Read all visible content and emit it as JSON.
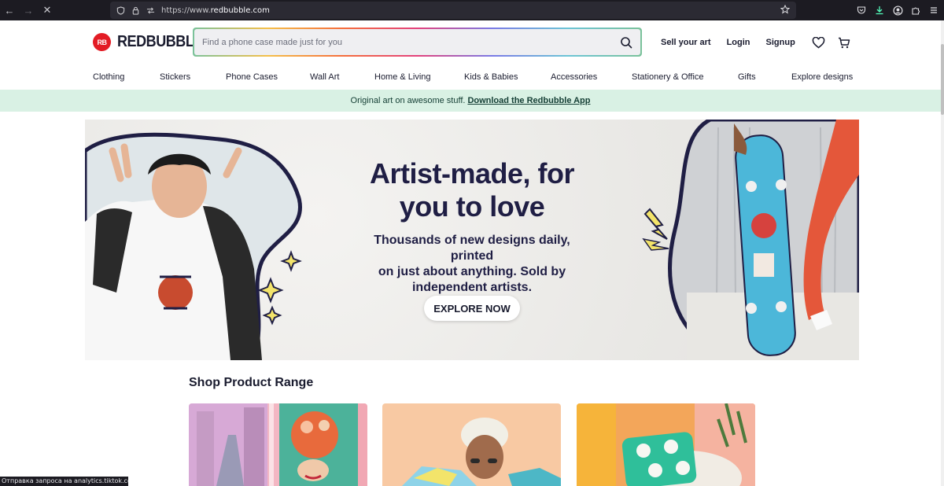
{
  "browser": {
    "url_prefix": "https://www.",
    "url_domain": "redbubble.com",
    "status_text": "Отправка запроса на analytics.tiktok.com..."
  },
  "header": {
    "logo_mark": "RB",
    "logo_text": "REDBUBBLE",
    "search_placeholder": "Find a phone case made just for you",
    "sell_label": "Sell your art",
    "login_label": "Login",
    "signup_label": "Signup"
  },
  "nav": {
    "items": [
      {
        "label": "Clothing"
      },
      {
        "label": "Stickers"
      },
      {
        "label": "Phone Cases"
      },
      {
        "label": "Wall Art"
      },
      {
        "label": "Home & Living"
      },
      {
        "label": "Kids & Babies"
      },
      {
        "label": "Accessories"
      },
      {
        "label": "Stationery & Office"
      },
      {
        "label": "Gifts"
      },
      {
        "label": "Explore designs"
      }
    ]
  },
  "promo": {
    "text": "Original art on awesome stuff.",
    "link": "Download the Redbubble App"
  },
  "hero": {
    "title_line1": "Artist-made, for",
    "title_line2": "you to love",
    "sub_line1": "Thousands of new designs daily, printed",
    "sub_line2": "on just about anything. Sold by",
    "sub_line3": "independent artists.",
    "cta": "EXPLORE NOW"
  },
  "range": {
    "title": "Shop Product Range"
  },
  "colors": {
    "brand_red": "#e31c25",
    "navy": "#1f1e44",
    "promo_bg": "#d9f1e4"
  }
}
